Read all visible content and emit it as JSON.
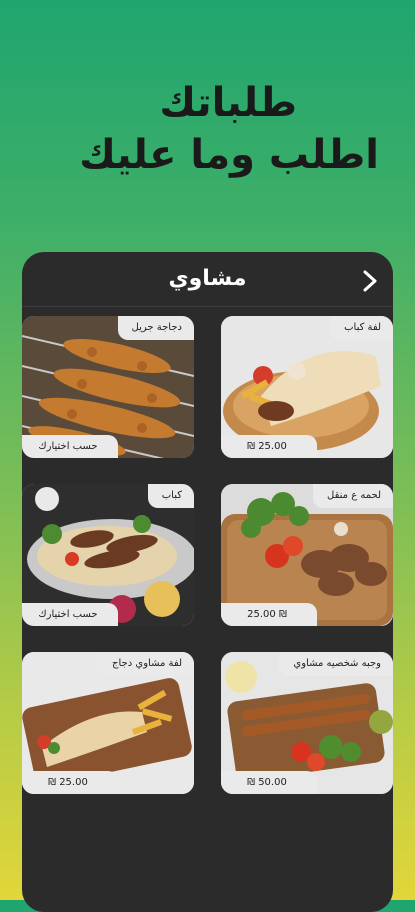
{
  "headline": {
    "line1": "طلباتك",
    "line2": "اطلب وما عليك"
  },
  "screen": {
    "title": "مشاوي",
    "back_icon": "chevron-right-icon"
  },
  "items": [
    {
      "name": "لفة كباب",
      "price": "25.00 ₪"
    },
    {
      "name": "دجاجة جريل",
      "price": "حسب اختيارك"
    },
    {
      "name": "لحمه ع منقل",
      "price": "₪ 25.00"
    },
    {
      "name": "كباب",
      "price": "حسب اختيارك"
    },
    {
      "name": "وجبه شخصيه مشاوي",
      "price": "50.00 ₪"
    },
    {
      "name": "لفة مشاوي دجاج",
      "price": "25.00 ₪"
    }
  ]
}
